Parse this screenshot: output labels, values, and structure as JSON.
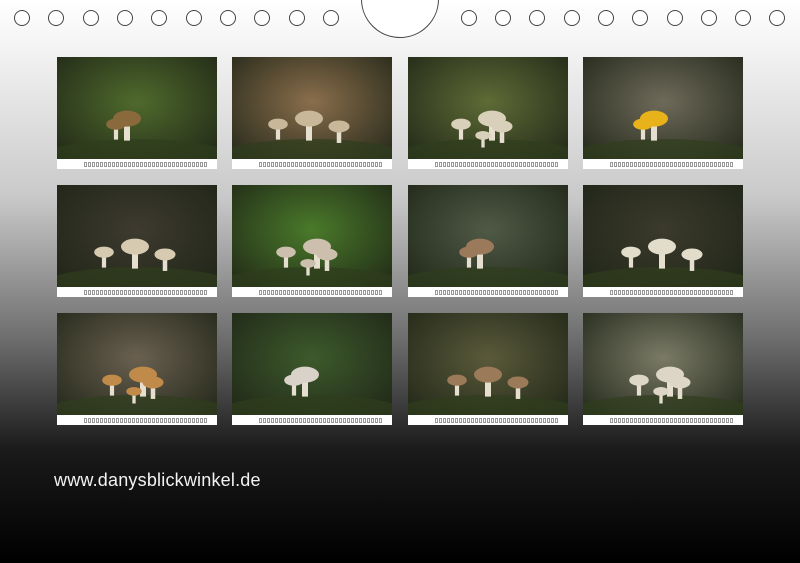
{
  "calendar": {
    "website": "www.danysblickwinkel.de",
    "tiles": [
      {
        "subject": "cluster-mushrooms-on-moss",
        "bg": "#4f6a2c",
        "fg": "#8a6a3c"
      },
      {
        "subject": "single-parasol-mushroom",
        "bg": "#8a6e4c",
        "fg": "#c9b79a"
      },
      {
        "subject": "mushrooms-on-mossy-stump",
        "bg": "#5e6b36",
        "fg": "#d8d0b8"
      },
      {
        "subject": "yellow-mushroom-on-bark",
        "bg": "#6e6a5a",
        "fg": "#e8b21a"
      },
      {
        "subject": "mushrooms-on-dark-log",
        "bg": "#3e3a30",
        "fg": "#d6cbb1"
      },
      {
        "subject": "mushrooms-in-green-moss",
        "bg": "#4a7a2a",
        "fg": "#cdbfae"
      },
      {
        "subject": "bracket-fungus-on-trunk",
        "bg": "#4f5a46",
        "fg": "#9a7a5a"
      },
      {
        "subject": "white-mushrooms-on-stump",
        "bg": "#3b3a2c",
        "fg": "#e2dccb"
      },
      {
        "subject": "turkey-tail-fungus",
        "bg": "#6a6050",
        "fg": "#c08a4a"
      },
      {
        "subject": "large-parasol-mushroom",
        "bg": "#3d5a2c",
        "fg": "#d8d2c8"
      },
      {
        "subject": "dense-mushroom-cluster",
        "bg": "#5a5a3a",
        "fg": "#9a7a58"
      },
      {
        "subject": "oyster-mushrooms-on-log",
        "bg": "#7a7a66",
        "fg": "#ddd6c6"
      }
    ]
  }
}
